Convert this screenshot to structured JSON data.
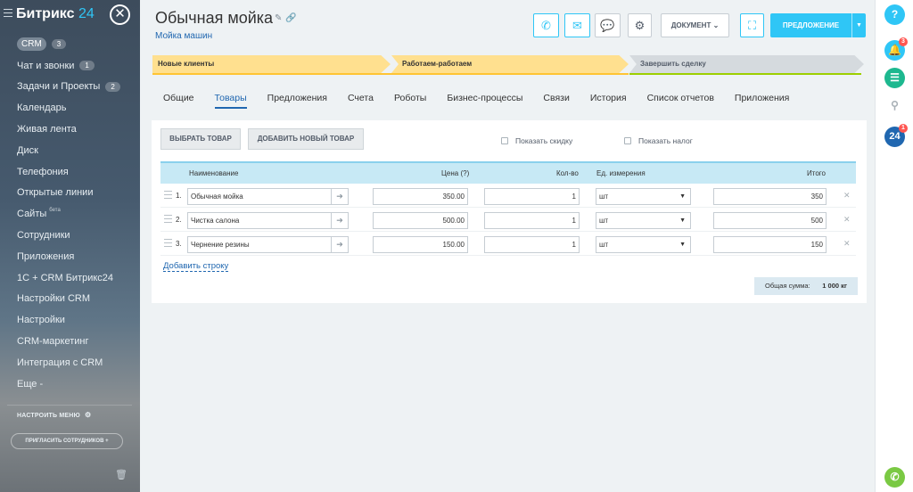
{
  "sidebar": {
    "logo_main": "Битрикс",
    "logo_num": "24",
    "crm_label": "CRM",
    "crm_count": "3",
    "items": [
      {
        "label": "Чат и звонки",
        "count": "1"
      },
      {
        "label": "Задачи и Проекты",
        "count": "2"
      },
      {
        "label": "Календарь"
      },
      {
        "label": "Живая лента"
      },
      {
        "label": "Диск"
      },
      {
        "label": "Телефония"
      },
      {
        "label": "Открытые линии"
      },
      {
        "label": "Сайты",
        "beta": "бета"
      },
      {
        "label": "Сотрудники"
      },
      {
        "label": "Приложения"
      },
      {
        "label": "1С + CRM Битрикс24"
      },
      {
        "label": "Настройки CRM"
      },
      {
        "label": "Настройки"
      },
      {
        "label": "CRM-маркетинг"
      },
      {
        "label": "Интеграция с CRM"
      },
      {
        "label": "Еще -"
      }
    ],
    "setup_menu": "НАСТРОИТЬ МЕНЮ",
    "invite": "ПРИГЛАСИТЬ СОТРУДНИКОВ +"
  },
  "header": {
    "title": "Обычная мойка",
    "subtitle": "Мойка машин",
    "document_label": "ДОКУМЕНТ",
    "offer_label": "ПРЕДЛОЖЕНИЕ"
  },
  "stages": [
    "Новые клиенты",
    "Работаем-работаем",
    "Завершить сделку"
  ],
  "tabs": [
    "Общие",
    "Товары",
    "Предложения",
    "Счета",
    "Роботы",
    "Бизнес-процессы",
    "Связи",
    "История",
    "Список отчетов",
    "Приложения"
  ],
  "products": {
    "select_btn": "ВЫБРАТЬ ТОВАР",
    "add_btn": "ДОБАВИТЬ НОВЫЙ ТОВАР",
    "show_discount": "Показать скидку",
    "show_tax": "Показать налог",
    "columns": {
      "name": "Наименование",
      "price": "Цена (?)",
      "qty": "Кол-во",
      "unit": "Ед. измерения",
      "total": "Итого"
    },
    "rows": [
      {
        "num": "1.",
        "name": "Обычная мойка",
        "price": "350.00",
        "qty": "1",
        "unit": "шт",
        "total": "350"
      },
      {
        "num": "2.",
        "name": "Чистка салона",
        "price": "500.00",
        "qty": "1",
        "unit": "шт",
        "total": "500"
      },
      {
        "num": "3.",
        "name": "Чернение резины",
        "price": "150.00",
        "qty": "1",
        "unit": "шт",
        "total": "150"
      }
    ],
    "add_row": "Добавить строку",
    "sum_label": "Общая сумма:",
    "sum_value": "1 000 кг"
  },
  "rail": {
    "help": "?",
    "notif_count": "3",
    "b24": "24",
    "b24_count": "1"
  },
  "colors": {
    "accent": "#2fc6f6",
    "link": "#2067b0",
    "stage_active": "#ffe08f",
    "stage_done_line": "#9dcf00"
  }
}
